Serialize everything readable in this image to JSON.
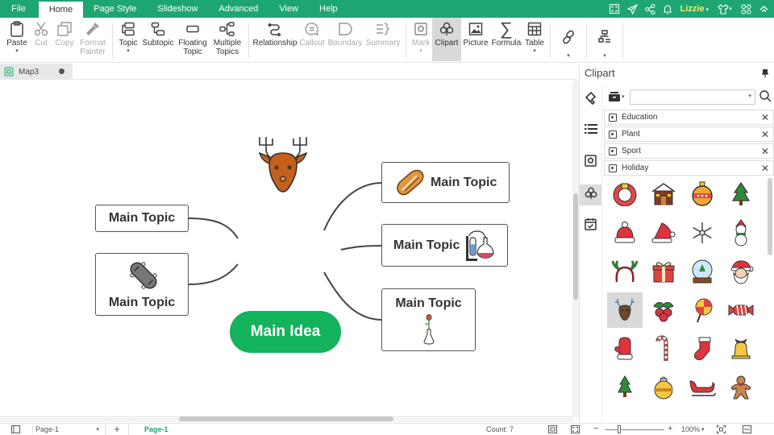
{
  "menu": {
    "tabs": [
      "File",
      "Home",
      "Page Style",
      "Slideshow",
      "Advanced",
      "View",
      "Help"
    ],
    "active": "Home",
    "user": "Lizzie"
  },
  "ribbon": {
    "paste": "Paste",
    "cut": "Cut",
    "copy": "Copy",
    "format_painter_1": "Format",
    "format_painter_2": "Painter",
    "topic": "Topic",
    "subtopic": "Subtopic",
    "floating_1": "Floating",
    "floating_2": "Topic",
    "multiple_1": "Multiple",
    "multiple_2": "Topics",
    "relationship": "Relationship",
    "callout": "Callout",
    "boundary": "Boundary",
    "summary": "Summary",
    "mark": "Mark",
    "clipart": "Clipart",
    "picture": "Picture",
    "formula": "Formula",
    "table": "Table"
  },
  "document": {
    "tab_name": "Map3",
    "unsaved": true
  },
  "mindmap": {
    "central": "Main Idea",
    "topics": [
      {
        "label": "Main Topic",
        "side": "left",
        "clipart": null
      },
      {
        "label": "Main Topic",
        "side": "left",
        "clipart": "skateboard"
      },
      {
        "label": "Main Topic",
        "side": "right",
        "clipart": "pecan"
      },
      {
        "label": "Main Topic",
        "side": "right",
        "clipart": "chemistry-flask"
      },
      {
        "label": "Main Topic",
        "side": "right",
        "clipart": "rose-vase"
      }
    ],
    "floating_clipart": "reindeer"
  },
  "panel": {
    "title": "Clipart",
    "search_value": "",
    "categories": [
      "Education",
      "Plant",
      "Sport",
      "Holiday"
    ],
    "clipart_items": [
      "wreath",
      "gingerbread-house",
      "ornament-bauble",
      "christmas-tree",
      "winter-hat",
      "santa-hat",
      "snowflake",
      "snowman",
      "reindeer-headband",
      "gift-box",
      "snow-globe",
      "santa-claus",
      "reindeer",
      "holly-berries",
      "lollipop",
      "candy",
      "mitten",
      "candy-cane",
      "christmas-stocking",
      "bell",
      "small-tree",
      "yellow-ornament",
      "sleigh",
      "gingerbread-man"
    ],
    "selected_item": "reindeer"
  },
  "status": {
    "page_select": "Page-1",
    "page_tab": "Page-1",
    "count": "Count: 7",
    "zoom": "100%",
    "zoom_level": 1.0
  },
  "colors": {
    "brand": "#1ea672",
    "central_topic": "#13b25d",
    "user_name": "#f3ea6a"
  }
}
